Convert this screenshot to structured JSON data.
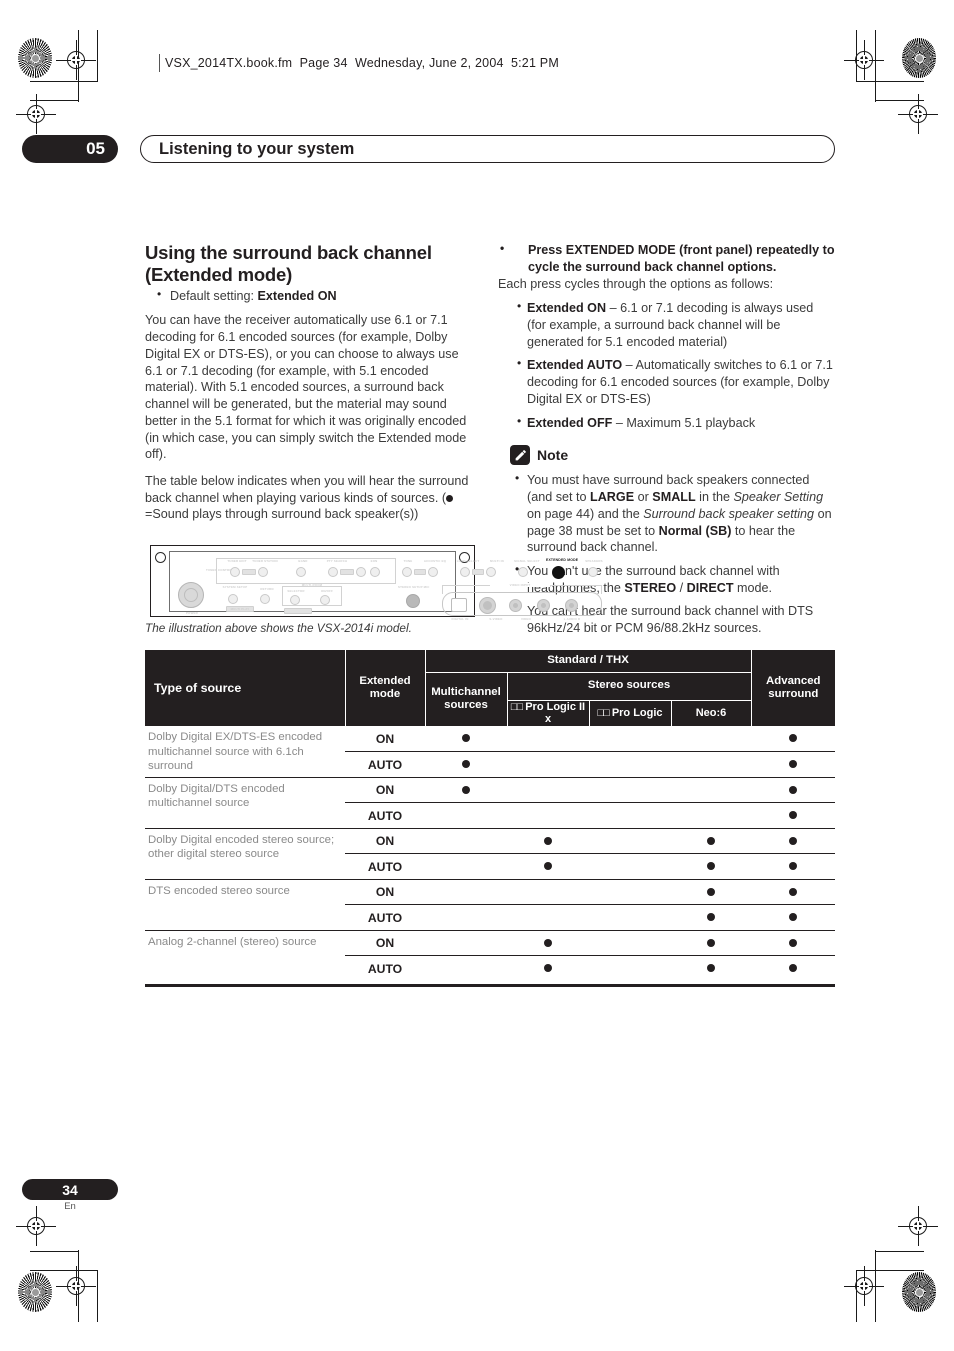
{
  "page": {
    "running_head": "VSX_2014TX.book.fm  Page 34  Wednesday, June 2, 2004  5:21 PM",
    "chapter_number": "05",
    "chapter_title": "Listening to your system",
    "folio_number": "34",
    "folio_lang": "En"
  },
  "left_column": {
    "heading_line1": "Using the surround back channel",
    "heading_line2": "(Extended mode)",
    "default_setting_prefix": "Default setting: ",
    "default_setting_value": "Extended ON",
    "para1": "You can have the receiver automatically use 6.1 or 7.1 decoding for 6.1 encoded sources (for example, Dolby Digital EX or DTS-ES), or you can choose to always use 6.1 or 7.1 decoding (for example, with 5.1 encoded material). With 5.1 encoded sources, a surround back channel will be generated, but the material may sound better in the 5.1 format for which it was originally encoded (in which case, you can simply switch the Extended mode off).",
    "para2_a": "The table below indicates when you will hear the surround back channel when playing various kinds of sources. (",
    "para2_b": "=Sound plays through surround back speaker(s))",
    "illustration_caption": "The illustration above shows the VSX-2014i model.",
    "panel_labels": {
      "extended_mode": "EXTENDED MODE",
      "tuner_control": "TUNER CONTROL",
      "tuner_edit": "TUNER EDIT",
      "tuner_station": "TUNER STATION",
      "band": "BAND",
      "ptv_search": "PTY SEARCH",
      "eon": "EON",
      "tone": "TONE",
      "acoustic_eq": "ACOUSTIC EQ",
      "loud_select": "LOUD SELECT",
      "multi_in": "MULTI IN",
      "signal_select": "SIGNAL SELECT",
      "speakers": "SPEAKERS",
      "system_setup": "SYSTEM SETUP",
      "return": "RETURN",
      "multi_room": "MULTI-ROOM",
      "selector": "SELECTOR",
      "on_off": "ON/OFF",
      "stereo_setup_mic": "STEREO SETUP MIC",
      "power": "POWER",
      "video_input": "VIDEO INPUT",
      "digital_in": "DIGITAL IN",
      "s_video": "S-VIDEO",
      "video": "VIDEO",
      "l_audio_r": "L  AUDIO  R",
      "multi_play": "MULTI PLAY"
    }
  },
  "right_column": {
    "lead_bullet": "Press EXTENDED MODE (front panel) repeatedly to cycle the surround back channel options.",
    "lead_sub": "Each press cycles through the options as follows:",
    "options": [
      {
        "term": "Extended ON",
        "desc": " – 6.1 or 7.1 decoding is always used (for example, a surround back channel will be generated for 5.1 encoded material)"
      },
      {
        "term": "Extended AUTO",
        "desc": " – Automatically switches to 6.1 or 7.1 decoding for 6.1 encoded sources (for example, Dolby Digital EX or DTS-ES)"
      },
      {
        "term": "Extended OFF",
        "desc": " – Maximum 5.1 playback"
      }
    ],
    "note_label": "Note",
    "notes": [
      {
        "part1": "You must have surround back speakers connected (and set to ",
        "bold1": "LARGE",
        "part2": " or ",
        "bold2": "SMALL",
        "part3": " in the ",
        "italic1": "Speaker Setting",
        "part4": " on page 44) and the ",
        "italic2": "Surround back speaker setting",
        "part5": " on page 38 must be set to ",
        "bold3": "Normal (SB)",
        "part6": " to hear the surround back channel."
      },
      {
        "part1": "You can't use the surround back channel with headphones, the ",
        "bold1": "STEREO",
        "part2": " / ",
        "bold2": "DIRECT",
        "part3": " mode."
      },
      {
        "part1": "You can't hear the surround back channel with DTS 96kHz/24 bit or PCM 96/88.2kHz sources."
      }
    ]
  },
  "table": {
    "header": {
      "type_of_source": "Type of source",
      "extended_mode": "Extended mode",
      "standard_thx": "Standard / THX",
      "multichannel_sources": "Multichannel sources",
      "stereo_sources": "Stereo sources",
      "pro_logic_iix": "Pro Logic II x",
      "pro_logic": "Pro Logic",
      "neo6": "Neo:6",
      "advanced_surround": "Advanced surround",
      "dolby_mark": "□□"
    },
    "columns": [
      "multichannel",
      "pro_logic_iix",
      "pro_logic",
      "neo6",
      "advanced_surround"
    ],
    "rows": [
      {
        "source": "Dolby Digital EX/DTS-ES encoded multichannel source with 6.1ch surround",
        "modes": [
          {
            "mode": "ON",
            "dots": [
              true,
              false,
              false,
              false,
              true
            ]
          },
          {
            "mode": "AUTO",
            "dots": [
              true,
              false,
              false,
              false,
              true
            ]
          }
        ]
      },
      {
        "source": "Dolby Digital/DTS encoded multichannel source",
        "modes": [
          {
            "mode": "ON",
            "dots": [
              true,
              false,
              false,
              false,
              true
            ]
          },
          {
            "mode": "AUTO",
            "dots": [
              false,
              false,
              false,
              false,
              true
            ]
          }
        ]
      },
      {
        "source": "Dolby Digital encoded stereo source; other digital stereo source",
        "modes": [
          {
            "mode": "ON",
            "dots": [
              false,
              true,
              false,
              true,
              true
            ]
          },
          {
            "mode": "AUTO",
            "dots": [
              false,
              true,
              false,
              true,
              true
            ]
          }
        ]
      },
      {
        "source": "DTS encoded stereo source",
        "modes": [
          {
            "mode": "ON",
            "dots": [
              false,
              false,
              false,
              true,
              true
            ]
          },
          {
            "mode": "AUTO",
            "dots": [
              false,
              false,
              false,
              true,
              true
            ]
          }
        ]
      },
      {
        "source": "Analog 2-channel (stereo) source",
        "modes": [
          {
            "mode": "ON",
            "dots": [
              false,
              true,
              false,
              true,
              true
            ]
          },
          {
            "mode": "AUTO",
            "dots": [
              false,
              true,
              false,
              true,
              true
            ]
          }
        ]
      }
    ]
  },
  "colors": {
    "ink": "#231f20",
    "body_text": "#3b3b3b",
    "table_source_text": "#8a8a8a"
  }
}
